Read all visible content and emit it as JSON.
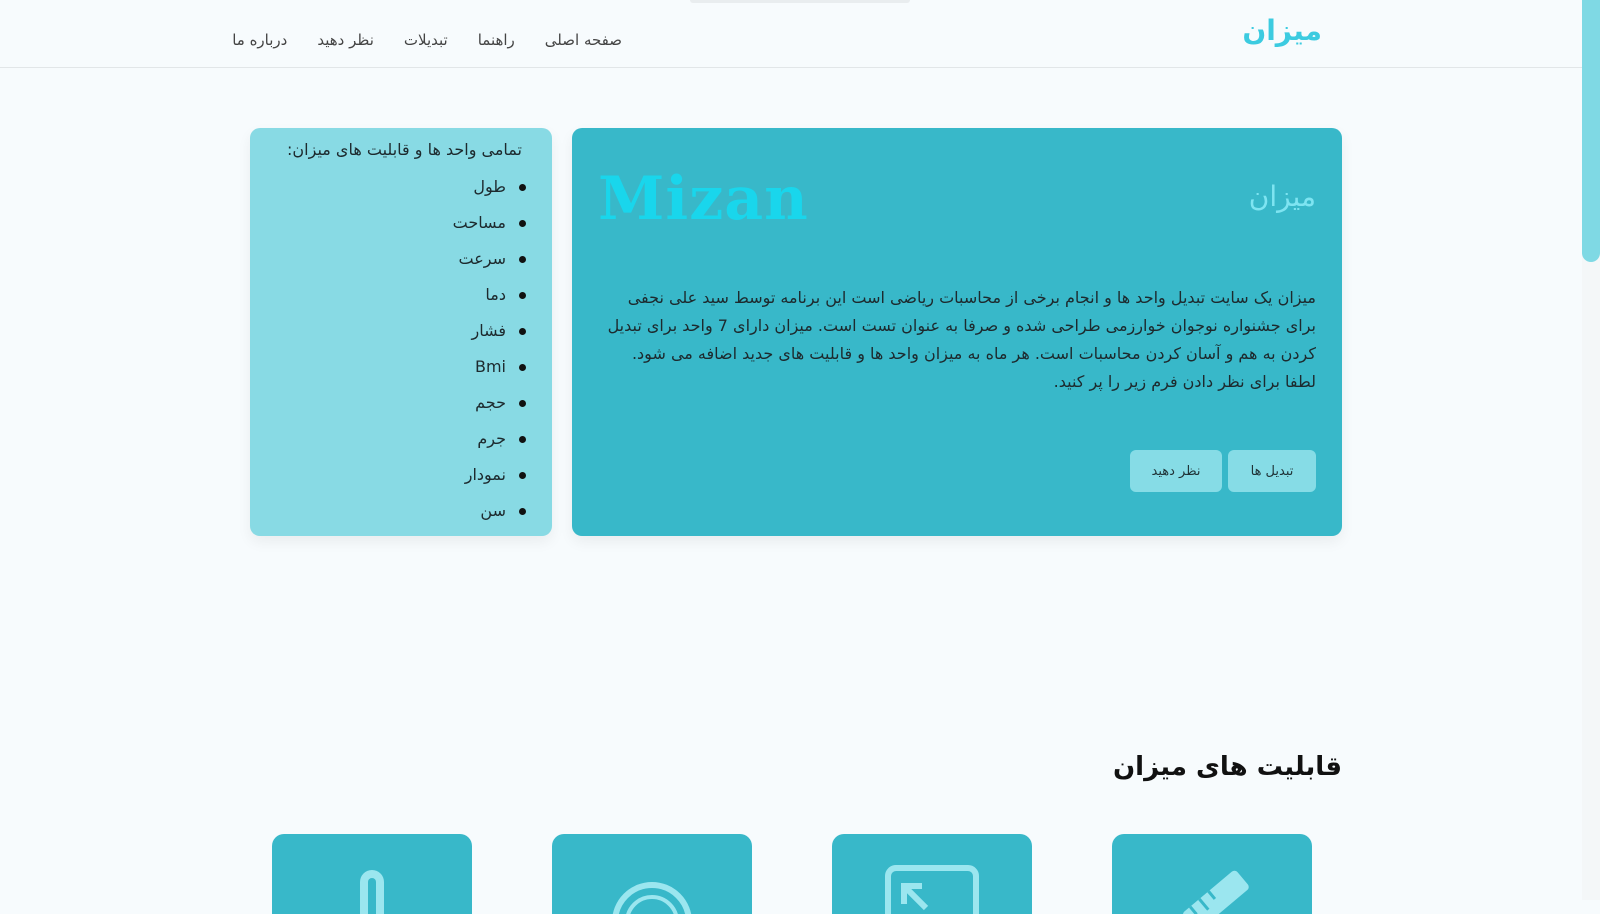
{
  "header": {
    "logo": "میزان",
    "nav": [
      {
        "label": "صفحه اصلی"
      },
      {
        "label": "راهنما"
      },
      {
        "label": "تبدیلات"
      },
      {
        "label": "نظر دهید"
      },
      {
        "label": "درباره ما"
      }
    ]
  },
  "hero": {
    "title": "میزان",
    "latin_title": "Mizan",
    "description": "میزان یک سایت تبدیل واحد ها و انجام برخی از محاسبات ریاضی است این برنامه توسط سید علی نجفی برای جشنواره نوجوان خوارزمی طراحی شده و صرفا به عنوان تست است. میزان دارای 7 واحد برای تبدیل کردن به هم و آسان کردن محاسبات است. هر ماه به میزان واحد ها و قابلیت های جدید اضافه می شود. لطفا برای نظر دادن فرم زیر را پر کنید.",
    "buttons": {
      "conversions": "تبدیل ها",
      "feedback": "نظر دهید"
    }
  },
  "sidebar": {
    "title": "تمامی واحد ها و قابلیت های میزان:",
    "items": [
      "طول",
      "مساحت",
      "سرعت",
      "دما",
      "فشار",
      "Bmi",
      "حجم",
      "جرم",
      "نمودار",
      "سن"
    ]
  },
  "features": {
    "heading": "قابلیت های میزان",
    "cards": [
      {
        "icon": "ruler-icon"
      },
      {
        "icon": "screen-arrow-icon"
      },
      {
        "icon": "gauge-icon"
      },
      {
        "icon": "thermometer-icon"
      }
    ]
  },
  "colors": {
    "accent": "#3ccbe0",
    "card": "#38b8c9",
    "card_light": "#88dae4",
    "button": "#86dce6"
  }
}
